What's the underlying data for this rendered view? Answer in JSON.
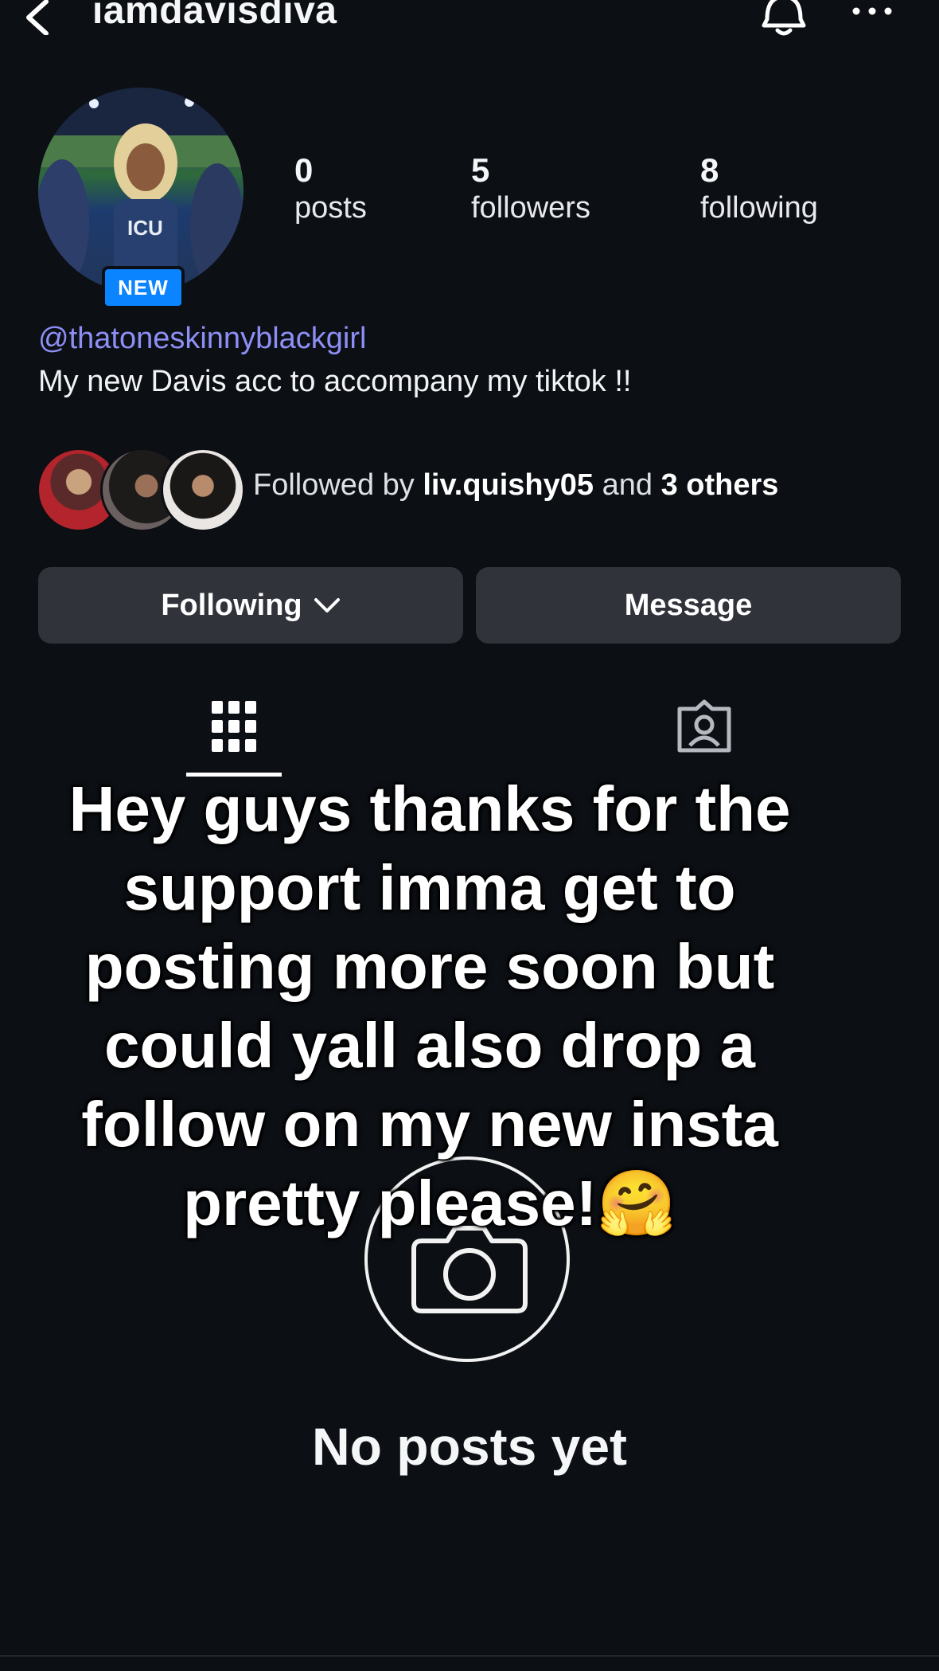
{
  "header": {
    "username": "iamdavisdiva",
    "icons": [
      "back-chevron-icon",
      "bell-icon",
      "more-dots-icon"
    ]
  },
  "profile": {
    "badge": "NEW",
    "stats": [
      {
        "value": "0",
        "label": "posts"
      },
      {
        "value": "5",
        "label": "followers"
      },
      {
        "value": "8",
        "label": "following"
      }
    ],
    "handle_link": "@thatoneskinnyblackgirl",
    "bio": "My new Davis acc to accompany my tiktok !!",
    "followed_by": {
      "prefix": "Followed by ",
      "user": "liv.quishy05",
      "middle": " and ",
      "others": "3 others"
    }
  },
  "actions": {
    "following_label": "Following",
    "message_label": "Message"
  },
  "tabs": [
    "grid-icon",
    "tagged-icon"
  ],
  "overlay_text": "Hey guys thanks for the support imma get to posting more soon but could yall also drop a follow on my new insta pretty please!🤗",
  "empty_state": {
    "text": "No posts yet"
  },
  "colors": {
    "background": "#0c0f14",
    "link": "#8d8ff5",
    "badge": "#0a84ff",
    "button": "#30333a"
  }
}
